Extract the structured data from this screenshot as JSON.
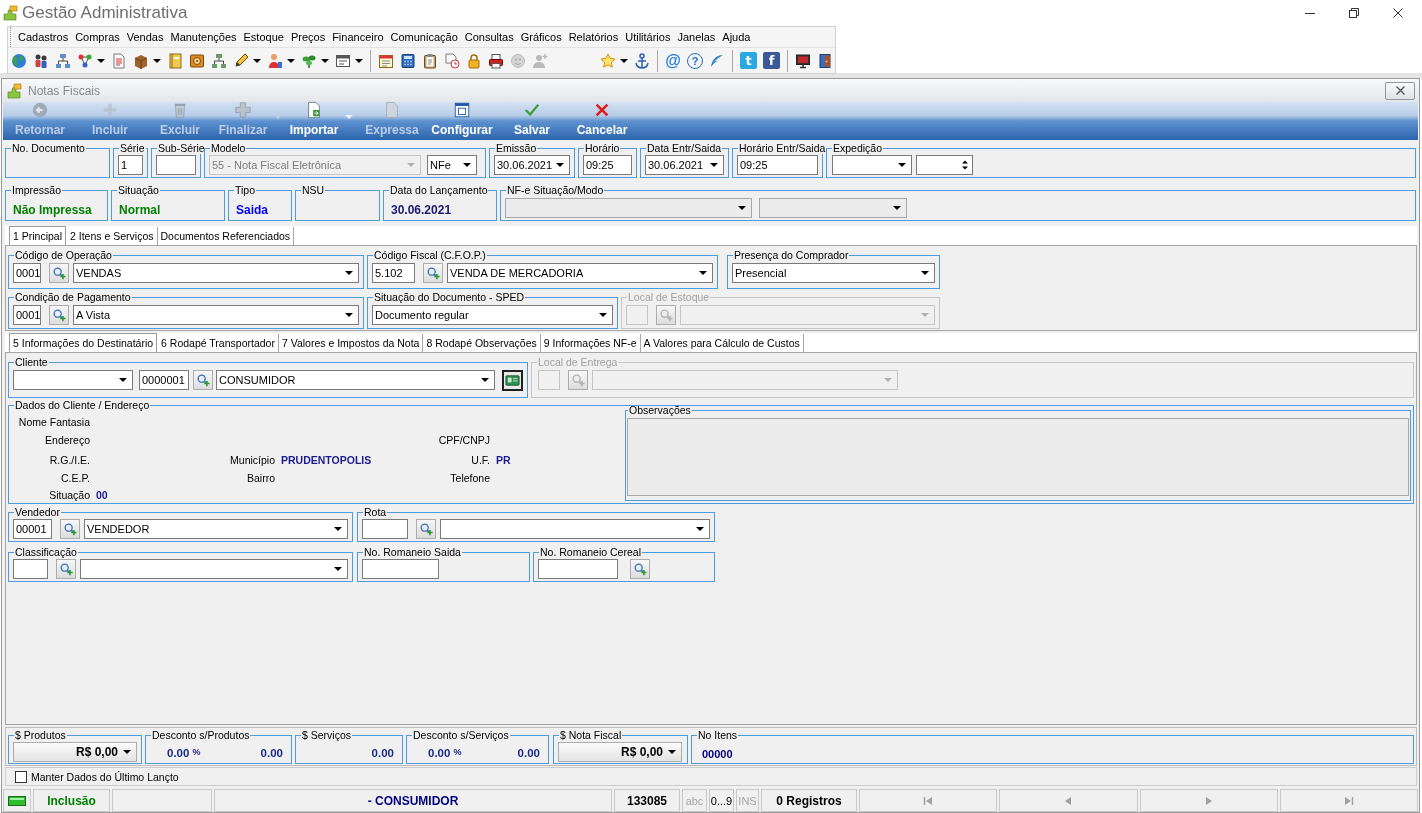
{
  "window": {
    "title": "Gestão Administrativa"
  },
  "menu": [
    "Cadastros",
    "Compras",
    "Vendas",
    "Manutenções",
    "Estoque",
    "Preços",
    "Financeiro",
    "Comunicação",
    "Consultas",
    "Gráficos",
    "Relatórios",
    "Utilitários",
    "Janelas",
    "Ajuda"
  ],
  "main_toolbar": [
    [
      {
        "dropdown": false,
        "disabled": false
      },
      {
        "dropdown": false,
        "disabled": false
      },
      {
        "dropdown": false,
        "disabled": false
      },
      {
        "dropdown": true,
        "disabled": false
      },
      {
        "dropdown": false,
        "disabled": false
      },
      {
        "dropdown": true,
        "disabled": false
      },
      {
        "dropdown": false,
        "disabled": false
      },
      {
        "dropdown": false,
        "disabled": false
      },
      {
        "dropdown": false,
        "disabled": false
      },
      {
        "dropdown": true,
        "disabled": false
      },
      {
        "dropdown": true,
        "disabled": false
      },
      {
        "dropdown": true,
        "disabled": false
      },
      {
        "dropdown": true,
        "disabled": false
      }
    ],
    [
      {
        "dropdown": false,
        "disabled": false
      },
      {
        "dropdown": false,
        "disabled": false
      },
      {
        "dropdown": false,
        "disabled": false
      },
      {
        "dropdown": false,
        "disabled": false
      },
      {
        "dropdown": false,
        "disabled": false
      },
      {
        "dropdown": false,
        "disabled": false
      },
      {
        "dropdown": false,
        "disabled": true
      },
      {
        "dropdown": false,
        "disabled": true
      }
    ],
    [
      {
        "dropdown": true,
        "disabled": false
      },
      {
        "dropdown": false,
        "disabled": false
      }
    ],
    [
      {
        "glyph": "@",
        "dropdown": false,
        "disabled": false
      },
      {
        "glyph": "?",
        "dropdown": false,
        "disabled": false
      },
      {
        "dropdown": false,
        "disabled": false
      }
    ],
    [
      {
        "glyph": "t",
        "dropdown": false,
        "disabled": false
      },
      {
        "glyph": "f",
        "dropdown": false,
        "disabled": false
      }
    ],
    [
      {
        "dropdown": false,
        "disabled": false
      },
      {
        "dropdown": false,
        "disabled": false
      }
    ]
  ],
  "child_window": {
    "title": "Notas Fiscais"
  },
  "form_toolbar": [
    {
      "label": "Retornar",
      "disabled": true,
      "dropdown": false
    },
    {
      "label": "Incluir",
      "disabled": true,
      "dropdown": false
    },
    {
      "label": "Excluir",
      "disabled": true,
      "dropdown": false
    },
    {
      "label": "Finalizar",
      "disabled": true,
      "dropdown": true
    },
    {
      "label": "Importar",
      "disabled": false,
      "dropdown": true
    },
    {
      "label": "Expressa",
      "disabled": true,
      "dropdown": false
    },
    {
      "label": "Configurar",
      "disabled": false,
      "dropdown": false
    },
    {
      "label": "Salvar",
      "disabled": false,
      "dropdown": false
    },
    {
      "label": "Cancelar",
      "disabled": false,
      "dropdown": false
    }
  ],
  "header_rows": [
    [
      {
        "title": "No. Documento"
      },
      {
        "title": "Série",
        "controls": [
          {
            "kind": "text",
            "value": "1"
          }
        ]
      },
      {
        "title": "Sub-Série",
        "controls": [
          {
            "kind": "text"
          }
        ]
      },
      {
        "title": "Modelo",
        "controls": [
          {
            "kind": "combo",
            "value": "55 - Nota Fiscal Eletrônica",
            "disabled": true
          },
          {
            "kind": "combo",
            "value": "NFe",
            "disabled": false
          }
        ]
      },
      {
        "title": "Emissão",
        "controls": [
          {
            "kind": "combo",
            "value": "30.06.2021"
          }
        ]
      },
      {
        "title": "Horário",
        "controls": [
          {
            "kind": "text",
            "value": "09:25"
          }
        ]
      },
      {
        "title": "Data Entr/Saida",
        "controls": [
          {
            "kind": "combo",
            "value": "30.06.2021"
          }
        ]
      },
      {
        "title": "Horário Entr/Saida",
        "controls": [
          {
            "kind": "text",
            "value": "09:25"
          }
        ]
      },
      {
        "title": "Expedição",
        "controls": [
          {
            "kind": "combo"
          },
          {
            "kind": "spin"
          }
        ]
      }
    ],
    [
      {
        "title": "Impressão",
        "controls": [
          {
            "kind": "display",
            "value": "Não Impressa",
            "color": "#008000"
          }
        ]
      },
      {
        "title": "Situação",
        "controls": [
          {
            "kind": "display",
            "value": "Normal",
            "color": "#008000"
          }
        ]
      },
      {
        "title": "Tipo",
        "controls": [
          {
            "kind": "display",
            "value": "Saida",
            "color": "#0000ff"
          }
        ]
      },
      {
        "title": "NSU"
      },
      {
        "title": "Data do Lançamento",
        "controls": [
          {
            "kind": "display",
            "value": "30.06.2021",
            "color": "#191970"
          }
        ]
      },
      {
        "title": "NF-e Situação/Modo",
        "controls": [
          {
            "kind": "list"
          },
          {
            "kind": "list"
          }
        ]
      }
    ]
  ],
  "main_tabs": [
    {
      "label": "1 Principal",
      "selected": true
    },
    {
      "label": "2 Itens e Serviços",
      "selected": false
    },
    {
      "label": "Documentos Referenciados",
      "selected": false
    }
  ],
  "principal_rows": [
    [
      {
        "title": "Código de Operação",
        "disabled": false,
        "controls": [
          {
            "kind": "text",
            "value": "0001"
          },
          {
            "kind": "lookup"
          },
          {
            "kind": "combo",
            "value": "VENDAS"
          }
        ]
      },
      {
        "title": "Código Fiscal (C.F.O.P.)",
        "disabled": false,
        "controls": [
          {
            "kind": "text",
            "value": "5.102"
          },
          {
            "kind": "lookup"
          },
          {
            "kind": "combo",
            "value": "VENDA DE MERCADORIA"
          }
        ]
      },
      {
        "title": "Presença do Comprador",
        "disabled": false,
        "controls": [
          {
            "kind": "combo",
            "value": "Presencial"
          }
        ]
      }
    ],
    [
      {
        "title": "Condição de Pagamento",
        "disabled": false,
        "controls": [
          {
            "kind": "text",
            "value": "0001"
          },
          {
            "kind": "lookup"
          },
          {
            "kind": "combo",
            "value": "A Vista"
          }
        ]
      },
      {
        "title": "Situação do Documento - SPED",
        "disabled": false,
        "controls": [
          {
            "kind": "combo",
            "value": "Documento regular"
          }
        ]
      },
      {
        "title": "Local de Estoque",
        "disabled": true,
        "controls": [
          {
            "kind": "text"
          },
          {
            "kind": "lookup"
          },
          {
            "kind": "combo"
          }
        ]
      }
    ]
  ],
  "detail_tabs": [
    {
      "label": "5 Informações do Destinatário",
      "selected": true
    },
    {
      "label": "6 Rodapé Transportador",
      "selected": false
    },
    {
      "label": "7 Valores e Impostos da Nota",
      "selected": false
    },
    {
      "label": "8 Rodapé Observações",
      "selected": false
    },
    {
      "label": "9 Informações NF-e",
      "selected": false
    },
    {
      "label": "A Valores para Cálculo de Custos",
      "selected": false
    }
  ],
  "client_row": [
    {
      "title": "Cliente",
      "disabled": false,
      "controls": [
        {
          "kind": "combo"
        },
        {
          "kind": "text",
          "value": "0000001"
        },
        {
          "kind": "lookup"
        },
        {
          "kind": "combo",
          "value": "CONSUMIDOR"
        },
        {
          "kind": "card"
        }
      ]
    },
    {
      "title": "Local de Entrega",
      "disabled": true,
      "controls": [
        {
          "kind": "text"
        },
        {
          "kind": "lookup"
        },
        {
          "kind": "combo"
        }
      ]
    }
  ],
  "client_data": {
    "title": "Dados do Cliente / Endereço",
    "fields": [
      {
        "label": "Nome Fantasia"
      },
      {
        "label": "Endereço"
      },
      {
        "label": "CPF/CNPJ"
      },
      {
        "label": "R.G./I.E."
      },
      {
        "label": "Município",
        "value": "PRUDENTOPOLIS"
      },
      {
        "label": "U.F.",
        "value": "PR"
      },
      {
        "label": "C.E.P."
      },
      {
        "label": "Bairro"
      },
      {
        "label": "Telefone"
      },
      {
        "label": "Situação",
        "value": "00"
      }
    ],
    "notes": {
      "title": "Observações"
    }
  },
  "detail_rows": [
    [
      {
        "title": "Vendedor",
        "controls": [
          {
            "kind": "text",
            "value": "00001"
          },
          {
            "kind": "lookup"
          },
          {
            "kind": "combo",
            "value": "VENDEDOR"
          }
        ]
      },
      {
        "title": "Rota",
        "controls": [
          {
            "kind": "text"
          },
          {
            "kind": "lookup"
          },
          {
            "kind": "combo"
          }
        ]
      }
    ],
    [
      {
        "title": "Classificação",
        "controls": [
          {
            "kind": "text"
          },
          {
            "kind": "lookup"
          },
          {
            "kind": "combo"
          }
        ]
      },
      {
        "title": "No. Romaneio Saida",
        "controls": [
          {
            "kind": "text"
          }
        ]
      },
      {
        "title": "No. Romaneio Cereal",
        "controls": [
          {
            "kind": "text"
          },
          {
            "kind": "lookup"
          }
        ]
      }
    ]
  ],
  "totals": [
    {
      "title": "$ Produtos",
      "controls": [
        {
          "kind": "money",
          "value": "R$ 0,00"
        }
      ]
    },
    {
      "title": "Desconto s/Produtos",
      "controls": [
        {
          "kind": "percent",
          "value": "0.00",
          "unit": "%"
        },
        {
          "kind": "number",
          "value": "0.00"
        }
      ]
    },
    {
      "title": "$ Serviços",
      "controls": [
        {
          "kind": "number",
          "value": "0.00"
        }
      ]
    },
    {
      "title": "Desconto s/Serviços",
      "controls": [
        {
          "kind": "percent",
          "value": "0.00",
          "unit": "%"
        },
        {
          "kind": "number",
          "value": "0.00"
        }
      ]
    },
    {
      "title": "$ Nota Fiscal",
      "controls": [
        {
          "kind": "money",
          "value": "R$ 0,00"
        }
      ]
    },
    {
      "title": "No Itens",
      "controls": [
        {
          "kind": "display",
          "value": "00000",
          "color": "#000080"
        }
      ]
    }
  ],
  "keep_data": {
    "label": "Manter Dados do Último Lançto",
    "checked": false
  },
  "status_bar": [
    {
      "kind": "led"
    },
    {
      "kind": "text",
      "text": "Inclusão",
      "color": "#008000"
    },
    {
      "kind": "blank"
    },
    {
      "kind": "text",
      "text": "- CONSUMIDOR",
      "color": "#000080"
    },
    {
      "kind": "text",
      "text": "133085",
      "color": "#000000"
    },
    {
      "kind": "key",
      "text": "abc",
      "disabled": true
    },
    {
      "kind": "key",
      "text": "0...9",
      "disabled": false
    },
    {
      "kind": "key",
      "text": "INS",
      "disabled": true
    },
    {
      "kind": "text",
      "text": "0 Registros",
      "color": "#000000"
    },
    {
      "kind": "nav",
      "disabled": true
    },
    {
      "kind": "nav",
      "disabled": true
    },
    {
      "kind": "nav",
      "disabled": true
    },
    {
      "kind": "nav",
      "disabled": true
    }
  ]
}
